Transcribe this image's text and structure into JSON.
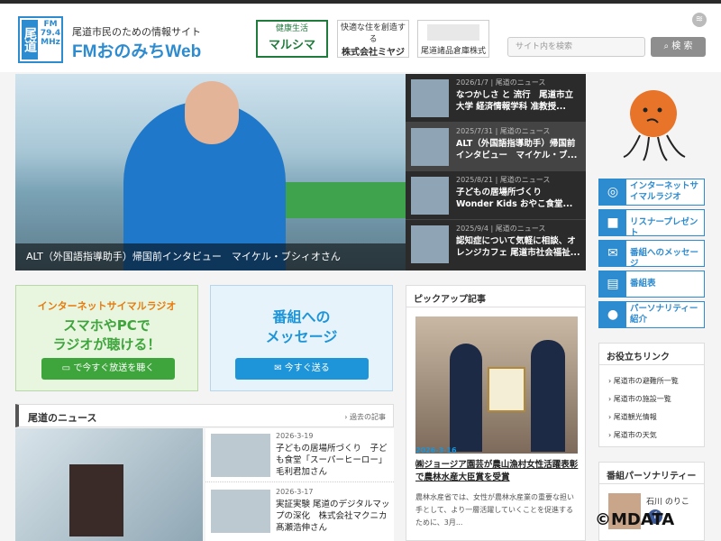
{
  "header": {
    "logo_text": "尾道",
    "logo_freq": "FM 79.4 MHz",
    "subtitle": "尾道市民のための情報サイト",
    "title": "FMおのみちWeb",
    "sponsors": [
      {
        "small": "健康生活",
        "big": "マルシマ"
      },
      {
        "small": "快適な住を創造する",
        "big": "株式会社ミヤジ"
      },
      {
        "small": "",
        "big": "尾道諸品倉庫株式会社"
      }
    ],
    "search_placeholder": "サイト内を検索",
    "search_button": "検 索"
  },
  "hero": {
    "caption": "ALT（外国語指導助手）帰国前インタビュー　マイケル・ブシィオさん"
  },
  "slider_news": [
    {
      "date": "2026/1/7",
      "cat": "尾道のニュース",
      "title": "なつかしさ と 流行　尾道市立大学 経済情報学科 准教授..."
    },
    {
      "date": "2025/7/31",
      "cat": "尾道のニュース",
      "title": "ALT（外国語指導助手）帰国前インタビュー　マイケル・ブ..."
    },
    {
      "date": "2025/8/21",
      "cat": "尾道のニュース",
      "title": "子どもの居場所づくり　Wonder Kids おやこ食堂..."
    },
    {
      "date": "2025/9/4",
      "cat": "尾道のニュース",
      "title": "認知症について気軽に相談、オレンジカフェ 尾道市社会福祉..."
    }
  ],
  "side_buttons": [
    {
      "icon": "◎",
      "label": "インターネットサイマルラジオ"
    },
    {
      "icon": "■",
      "label": "リスナープレゼント"
    },
    {
      "icon": "✉",
      "label": "番組へのメッセージ"
    },
    {
      "icon": "▤",
      "label": "番組表"
    },
    {
      "icon": "●",
      "label": "パーソナリティー紹介"
    }
  ],
  "banner_radio": {
    "line1": "インターネットサイマルラジオ",
    "line2a": "スマホやPCで",
    "line2b": "ラジオが聴ける！",
    "button": "で今すぐ放送を聴く"
  },
  "banner_message": {
    "line1": "番組への",
    "line2": "メッセージ",
    "button": "今すぐ送る"
  },
  "news_section": {
    "title": "尾道のニュース",
    "more": "過去の記事",
    "items": [
      {
        "date": "2026-3-19",
        "title": "子どもの居場所づくり　子ども食堂「スーパーヒーロー」毛利君加さん"
      },
      {
        "date": "2026-3-17",
        "title": "実証実験 尾道のデジタルマップの深化　株式会社マクニカ 髙瀬浩伸さん"
      }
    ]
  },
  "pickup": {
    "title": "ピックアップ記事",
    "date": "2026-3-16",
    "article_title": "㈱ジョージア園芸が農山漁村女性活躍表彰で農林水産大臣賞を受賞",
    "desc": "農林水産省では、女性が農林水産業の重要な担い手として、より一層活躍していくことを促進するために、3月..."
  },
  "useful_links": {
    "title": "お役立ちリンク",
    "items": [
      "尾道市の避難所一覧",
      "尾道市の施設一覧",
      "尾道観光情報",
      "尾道市の天気"
    ]
  },
  "personality": {
    "title": "番組パーソナリティー",
    "name": "石川 のりこ"
  },
  "watermark": "©MDATA"
}
